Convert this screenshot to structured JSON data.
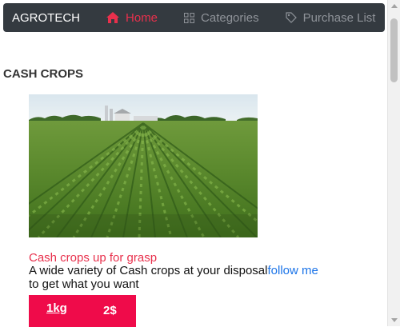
{
  "navbar": {
    "brand": "AGROTECH",
    "home": "Home",
    "categories": "Categories",
    "purchase_list": "Purchase List"
  },
  "section": {
    "title": "CASH CROPS"
  },
  "card": {
    "title": "Cash crops up for grasp",
    "description": "A wide variety of Cash crops at your disposal",
    "link": "follow me",
    "description_end": "to get what you want",
    "quantity": "1kg",
    "price": "2$"
  },
  "colors": {
    "accent": "#e8304c",
    "navbar_bg": "#343a40",
    "price_bg": "#ef0b4a",
    "link": "#1a73e8"
  },
  "icons": {
    "home": "home-icon",
    "categories": "grid-icon",
    "purchase_list": "tag-icon"
  }
}
